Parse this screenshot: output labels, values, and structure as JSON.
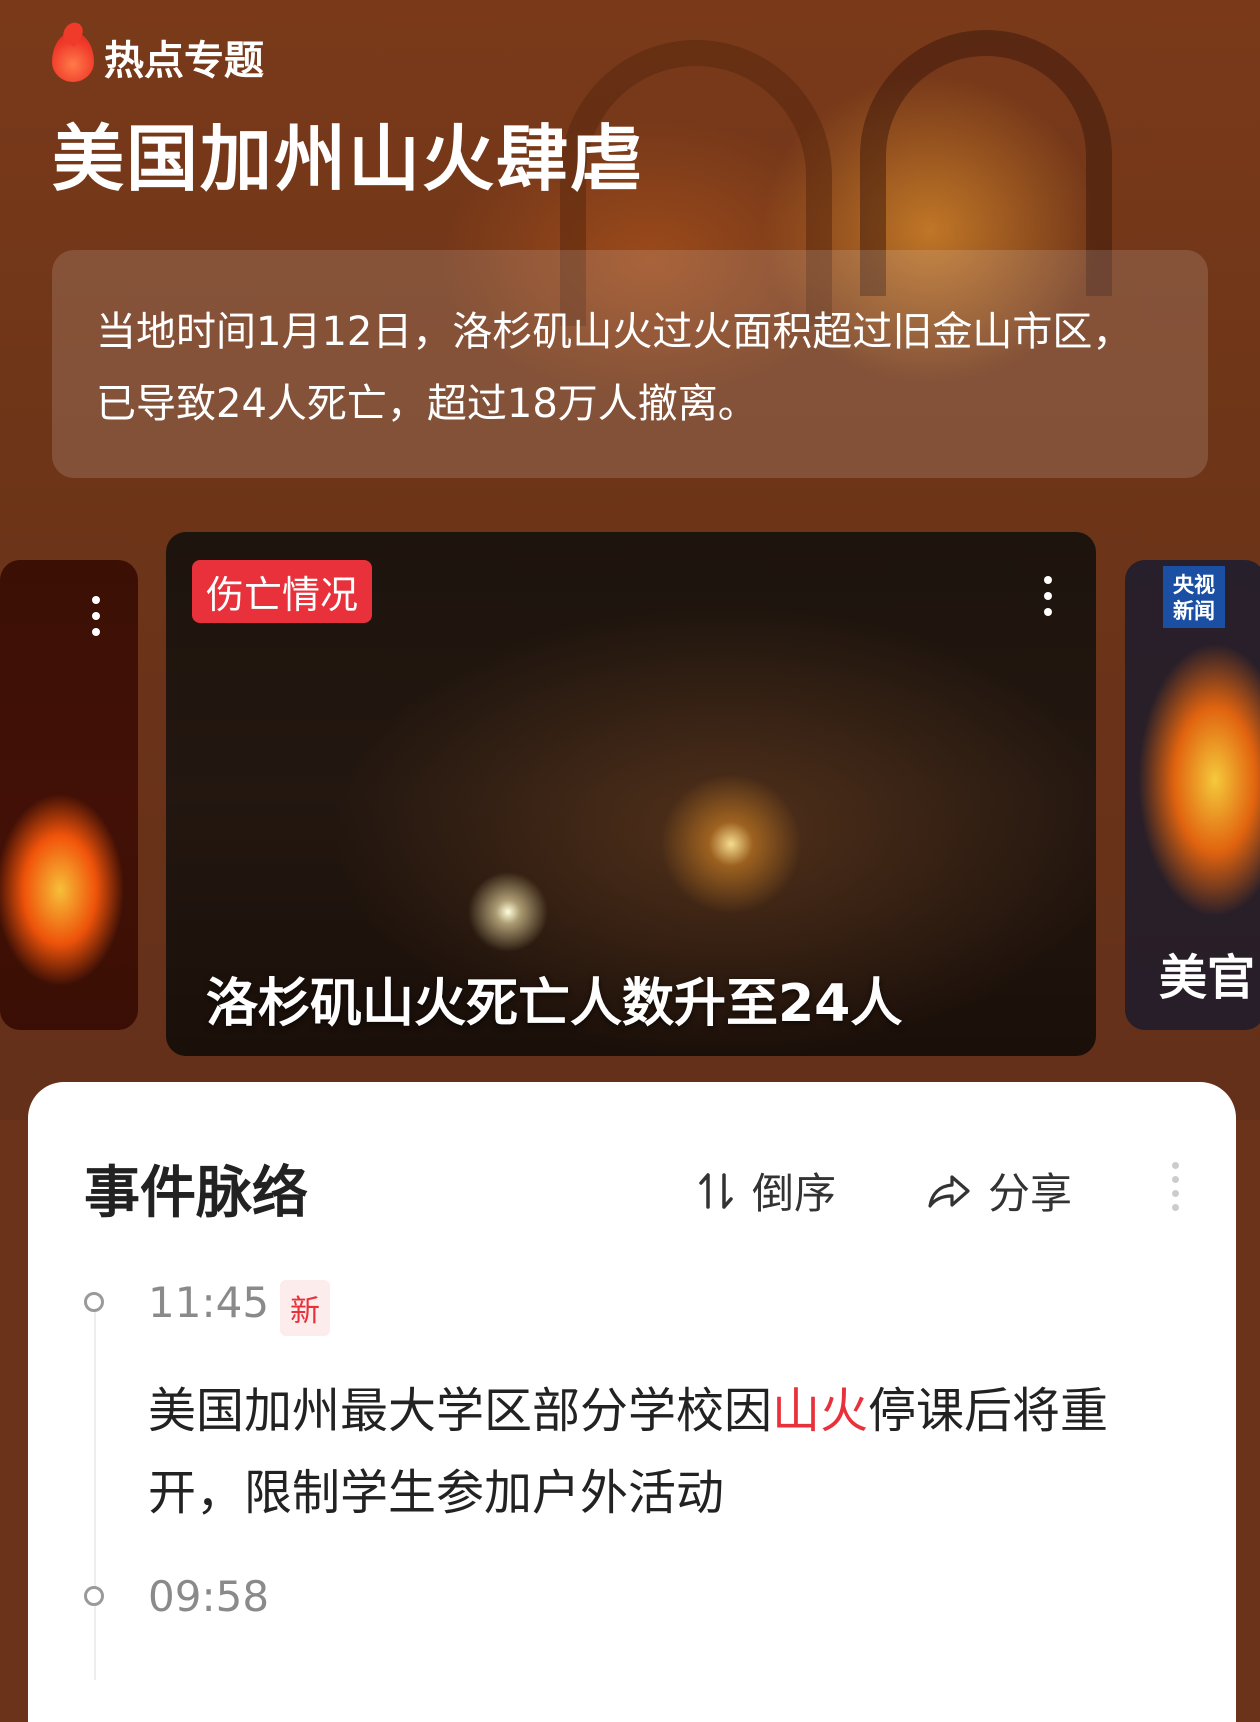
{
  "header": {
    "topic_label": "热点专题",
    "title": "美国加州山火肆虐",
    "summary": "当地时间1月12日，洛杉矶山火过火面积超过旧金山市区，已导致24人死亡，超过18万人撤离。"
  },
  "carousel": {
    "main_card": {
      "tag": "伤亡情况",
      "caption": "洛杉矶山火死亡人数升至24人"
    },
    "right_card": {
      "logo_line1": "央视",
      "logo_line2": "新闻",
      "caption": "美官"
    }
  },
  "timeline": {
    "title": "事件脉络",
    "sort_label": "倒序",
    "share_label": "分享",
    "items": [
      {
        "time": "11:45",
        "badge": "新",
        "text_before": "美国加州最大学区部分学校因",
        "text_highlight": "山火",
        "text_after": "停课后将重开，限制学生参加户外活动"
      },
      {
        "time": "09:58"
      }
    ]
  },
  "colors": {
    "accent_red": "#e8313a",
    "hero_brown": "#6b3319"
  }
}
